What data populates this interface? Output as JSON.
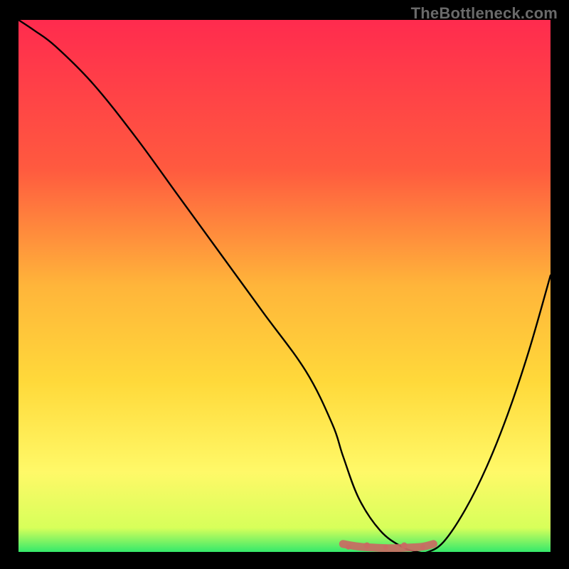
{
  "watermark": "TheBottleneck.com",
  "colors": {
    "background": "#000000",
    "gradient_top": "#ff2b4e",
    "gradient_mid_upper": "#ff7a3a",
    "gradient_mid": "#ffd93a",
    "gradient_mid_lower": "#fff968",
    "gradient_bottom": "#35e96b",
    "curve": "#000000",
    "flat_marker": "#c96a63",
    "watermark_text": "#6a6a6a"
  },
  "chart_data": {
    "type": "line",
    "title": "",
    "xlabel": "",
    "ylabel": "",
    "xlim": [
      0,
      100
    ],
    "ylim": [
      0,
      100
    ],
    "series": [
      {
        "name": "bottleneck-curve",
        "x": [
          0,
          3,
          7,
          14,
          22,
          30,
          38,
          46,
          54,
          59,
          61,
          64,
          68,
          72,
          75,
          77,
          80,
          84,
          88,
          92,
          96,
          100
        ],
        "values": [
          100,
          98,
          95,
          88,
          78,
          67,
          56,
          45,
          34,
          24,
          18,
          10,
          4,
          1,
          0,
          0,
          2,
          8,
          16,
          26,
          38,
          52
        ]
      },
      {
        "name": "optimal-flat",
        "x": [
          61,
          64,
          67,
          70,
          73,
          76,
          78
        ],
        "values": [
          1.5,
          1.0,
          0.8,
          0.7,
          0.8,
          1.0,
          1.5
        ]
      }
    ],
    "annotations": []
  }
}
